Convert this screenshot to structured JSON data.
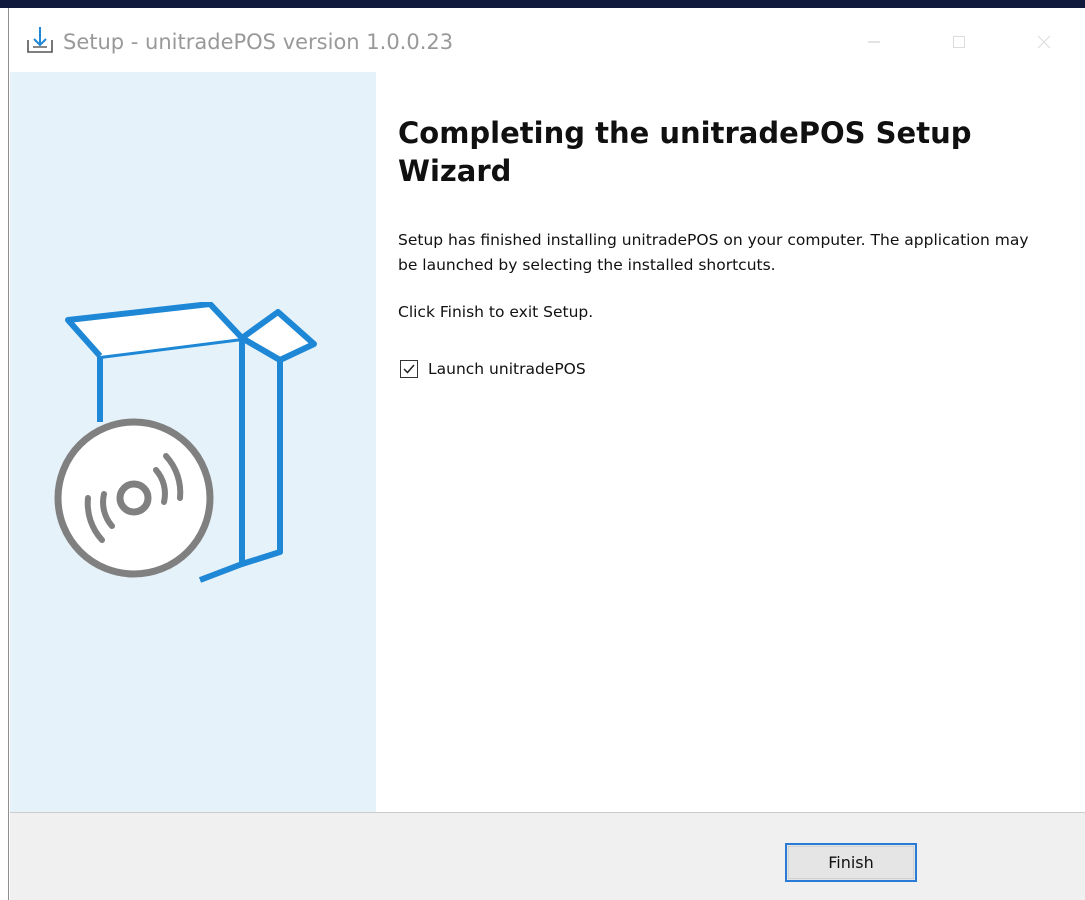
{
  "window": {
    "title": "Setup - unitradePOS version 1.0.0.23"
  },
  "main": {
    "heading": "Completing the unitradePOS Setup Wizard",
    "paragraph_1": "Setup has finished installing unitradePOS on your computer. The application may be launched by selecting the installed shortcuts.",
    "paragraph_2": "Click Finish to exit Setup.",
    "launch_option": {
      "label": "Launch unitradePOS",
      "checked": true
    }
  },
  "footer": {
    "finish_label": "Finish"
  },
  "icons": {
    "title": "install-download-icon",
    "illustration": "software-box-disc-icon",
    "minimize": "minimize-icon",
    "maximize": "maximize-icon",
    "close": "close-icon",
    "checkmark": "checkmark-icon"
  },
  "colors": {
    "accent": "#1e88d6",
    "side_panel": "#e6f2fa",
    "disc": "#808080",
    "button_border": "#2a7bd6",
    "footer": "#f0f0f0"
  }
}
